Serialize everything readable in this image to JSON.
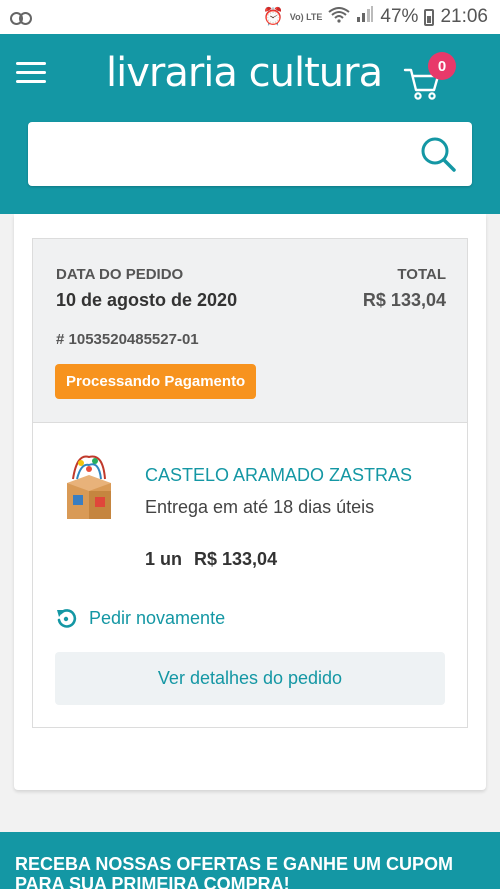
{
  "status_bar": {
    "battery_percent": "47%",
    "time": "21:06",
    "network_label": "Vo) LTE"
  },
  "header": {
    "logo_text": "livraria cultura",
    "cart_count": "0",
    "search": {
      "placeholder": "",
      "value": ""
    }
  },
  "order": {
    "date_label": "DATA DO PEDIDO",
    "date_value": "10 de agosto de 2020",
    "total_label": "TOTAL",
    "total_value": "R$ 133,04",
    "order_number": "# 1053520485527-01",
    "status": "Processando Pagamento",
    "status_color": "#f7931e",
    "item": {
      "name": "CASTELO ARAMADO ZASTRAS",
      "delivery": "Entrega em até 18 dias úteis",
      "quantity": "1 un",
      "price": "R$ 133,04"
    },
    "reorder_label": "Pedir novamente",
    "details_label": "Ver detalhes do pedido"
  },
  "footer": {
    "banner_text": "RECEBA NOSSAS OFERTAS E GANHE UM CUPOM PARA SUA PRIMEIRA COMPRA!"
  },
  "colors": {
    "brand": "#1497a4",
    "badge": "#e8396a",
    "status": "#f7931e"
  }
}
